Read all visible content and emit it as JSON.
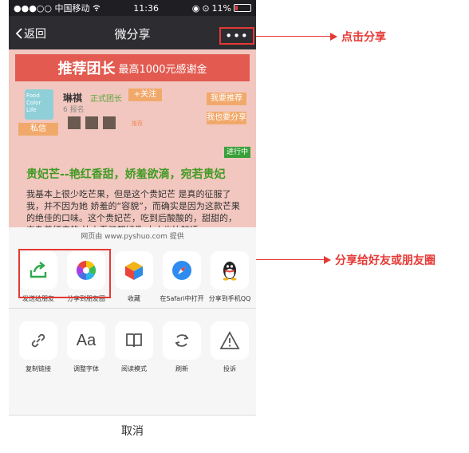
{
  "status_bar": {
    "carrier": "●●●○○ 中国移动",
    "time": "11:36",
    "battery": "11%"
  },
  "nav": {
    "back_label": "返回",
    "title": "微分享",
    "more_label": "•••"
  },
  "banner": {
    "title": "推荐团长",
    "subtitle": "最高1000元感谢金"
  },
  "leader": {
    "avatar_text": "Food Color Life",
    "name": "琳祺",
    "role": "正式团长",
    "follow_label": "+关注",
    "stats": "6 报名",
    "private_label": "私信",
    "thumb_label": "推荐",
    "recommend_label": "我要推荐",
    "share_label": "我也要分享"
  },
  "article": {
    "status": "进行中",
    "title": "贵妃芒--艳红香甜，娇羞欲滴，宛若贵妃",
    "body": "我基本上很少吃芒果，但是这个贵妃芒 是真的征服了我，并不因为她 娇羞的“容貌”，而确实是因为这款芒果的绝佳的口味。这个贵妃芒，吃到后酸酸的，甜甜的，夹杂着红皮的 让人看了都好像 大小也比较适"
  },
  "share_sheet": {
    "source": "网页由 www.pyshuo.com 提供",
    "row1": [
      {
        "label": "发送给朋友",
        "icon": "share-arrow-icon"
      },
      {
        "label": "分享到朋友圈",
        "icon": "moments-icon"
      },
      {
        "label": "收藏",
        "icon": "favorite-cube-icon"
      },
      {
        "label": "在Safari中打开",
        "icon": "safari-icon"
      },
      {
        "label": "分享到手机QQ",
        "icon": "qq-penguin-icon"
      }
    ],
    "row2": [
      {
        "label": "复制链接",
        "icon": "link-icon"
      },
      {
        "label": "调整字体",
        "icon": "font-icon",
        "glyph": "Aa"
      },
      {
        "label": "阅读模式",
        "icon": "book-icon"
      },
      {
        "label": "刷新",
        "icon": "refresh-icon"
      },
      {
        "label": "投诉",
        "icon": "warning-icon"
      }
    ],
    "cancel": "取消"
  },
  "annotations": {
    "top": "点击分享",
    "middle": "分享给好友或朋友圈"
  },
  "colors": {
    "accent_red": "#e53935",
    "nav_dark": "#2d2d31",
    "title_green": "#3f9a22",
    "button_orange": "#f1a96b"
  }
}
